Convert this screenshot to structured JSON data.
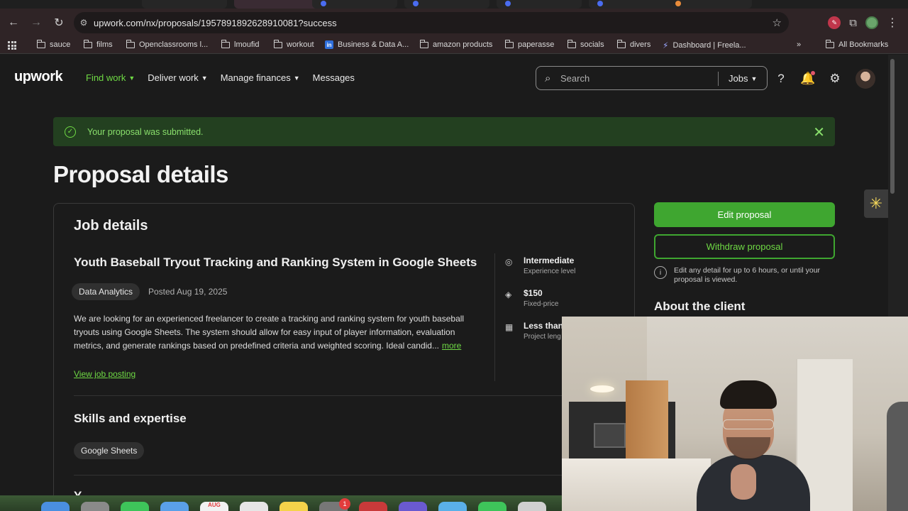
{
  "browser": {
    "url": "upwork.com/nx/proposals/1957891892628910081?success",
    "bookmarks": [
      {
        "label": "sauce",
        "icon": "folder-icon"
      },
      {
        "label": "films",
        "icon": "folder-icon"
      },
      {
        "label": "Openclassrooms l...",
        "icon": "folder-icon"
      },
      {
        "label": "lmoufid",
        "icon": "folder-icon"
      },
      {
        "label": "workout",
        "icon": "folder-icon"
      },
      {
        "label": "Business & Data A...",
        "icon": "linkedin-icon"
      },
      {
        "label": "amazon products",
        "icon": "folder-icon"
      },
      {
        "label": "paperasse",
        "icon": "folder-icon"
      },
      {
        "label": "socials",
        "icon": "folder-icon"
      },
      {
        "label": "divers",
        "icon": "folder-icon"
      },
      {
        "label": "Dashboard | Freela...",
        "icon": "site-icon"
      }
    ],
    "more_bookmarks": "»",
    "all_bookmarks": "All Bookmarks",
    "linkedin_glyph": "in"
  },
  "header": {
    "logo": "upwork",
    "nav": [
      {
        "label": "Find work",
        "active": true
      },
      {
        "label": "Deliver work",
        "active": false
      },
      {
        "label": "Manage finances",
        "active": false
      },
      {
        "label": "Messages",
        "active": false
      }
    ],
    "search_placeholder": "Search",
    "search_scope": "Jobs"
  },
  "banner": {
    "message": "Your proposal was submitted."
  },
  "page_title": "Proposal details",
  "job": {
    "section_title": "Job details",
    "title": "Youth Baseball Tryout Tracking and Ranking System in Google Sheets",
    "category": "Data Analytics",
    "posted": "Posted Aug 19, 2025",
    "description": "We are looking for an experienced freelancer to create a tracking and ranking system for youth baseball tryouts using Google Sheets. The system should allow for easy input of player information, evaluation metrics, and generate rankings based on predefined criteria and weighted scoring. Ideal candid...",
    "more_label": "more",
    "view_link": "View job posting",
    "meta": [
      {
        "value": "Intermediate",
        "label": "Experience level",
        "icon": "brain-icon"
      },
      {
        "value": "$150",
        "label": "Fixed-price",
        "icon": "price-tag-icon"
      },
      {
        "value": "Less than",
        "label": "Project leng",
        "icon": "calendar-icon"
      }
    ]
  },
  "skills": {
    "title": "Skills and expertise",
    "items": [
      "Google Sheets"
    ]
  },
  "next_section_title": "Y",
  "actions": {
    "edit": "Edit proposal",
    "withdraw": "Withdraw proposal",
    "info": "Edit any detail for up to 6 hours, or until your proposal is viewed."
  },
  "about_client_title": "About the client",
  "dock": {
    "calendar_month": "AUG",
    "notification_count": "1"
  },
  "colors": {
    "accent_green": "#6fda44",
    "button_green": "#3fa630",
    "banner_bg": "#234020",
    "page_bg": "#1b1b1b"
  }
}
